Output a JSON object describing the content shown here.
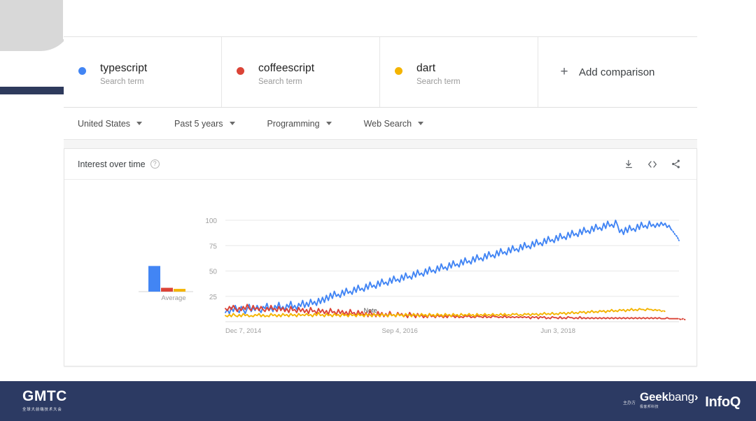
{
  "terms": [
    {
      "name": "typescript",
      "subtitle": "Search term",
      "color": "#4285F4",
      "dot_name": "legend-dot-typescript"
    },
    {
      "name": "coffeescript",
      "subtitle": "Search term",
      "color": "#DB4437",
      "dot_name": "legend-dot-coffeescript"
    },
    {
      "name": "dart",
      "subtitle": "Search term",
      "color": "#F4B400",
      "dot_name": "legend-dot-dart"
    }
  ],
  "add_comparison": {
    "plus": "+",
    "label": "Add comparison"
  },
  "filters": [
    {
      "label": "United States"
    },
    {
      "label": "Past 5 years"
    },
    {
      "label": "Programming"
    },
    {
      "label": "Web Search"
    }
  ],
  "card": {
    "title": "Interest over time",
    "help": "?",
    "actions": [
      {
        "name": "download-icon"
      },
      {
        "name": "embed-code-icon"
      },
      {
        "name": "share-icon"
      }
    ]
  },
  "banner": {
    "gmtc_main": "GMTC",
    "gmtc_sub": "全球大前端技术大会",
    "sponsor_label": "主办方",
    "geekbang_geek": "Geek",
    "geekbang_bang": "bang",
    "geekbang_arrow": "›",
    "geekbang_sub": "极客邦科技",
    "infoq": "InfoQ"
  },
  "chart_data": {
    "type": "line",
    "title": "Interest over time",
    "xlabel": "",
    "ylabel": "",
    "ylim": [
      0,
      100
    ],
    "yticks": [
      25,
      50,
      75,
      100
    ],
    "ytick_labels": [
      "25",
      "50",
      "75",
      "100"
    ],
    "xtick_labels": [
      "Dec 7, 2014",
      "Sep 4, 2016",
      "Jun 3, 2018"
    ],
    "xtick_positions": [
      0.0,
      0.345,
      0.695
    ],
    "grid": true,
    "legend": "top",
    "annotation": "Note",
    "annotation_pos": [
      0.305,
      0.09
    ],
    "partial_data_dotted_tail": true,
    "series": [
      {
        "name": "typescript",
        "color": "#4285F4",
        "average": 47,
        "values": [
          9,
          12,
          8,
          14,
          10,
          16,
          11,
          9,
          15,
          12,
          8,
          13,
          17,
          10,
          14,
          11,
          16,
          12,
          9,
          15,
          13,
          18,
          11,
          14,
          10,
          16,
          13,
          19,
          12,
          15,
          11,
          17,
          14,
          20,
          13,
          16,
          12,
          18,
          15,
          21,
          14,
          19,
          15,
          22,
          17,
          20,
          16,
          23,
          18,
          24,
          19,
          26,
          21,
          28,
          23,
          30,
          25,
          27,
          24,
          31,
          26,
          33,
          28,
          30,
          27,
          34,
          29,
          36,
          31,
          33,
          30,
          37,
          32,
          39,
          34,
          36,
          33,
          40,
          35,
          42,
          37,
          39,
          36,
          43,
          38,
          45,
          40,
          42,
          39,
          46,
          41,
          48,
          43,
          45,
          42,
          49,
          44,
          51,
          46,
          48,
          45,
          52,
          47,
          54,
          49,
          51,
          48,
          55,
          50,
          57,
          52,
          54,
          51,
          58,
          53,
          60,
          55,
          57,
          54,
          61,
          56,
          63,
          58,
          60,
          57,
          64,
          59,
          66,
          61,
          63,
          60,
          67,
          62,
          69,
          64,
          66,
          63,
          70,
          65,
          72,
          67,
          69,
          66,
          73,
          68,
          75,
          70,
          72,
          69,
          76,
          71,
          78,
          73,
          75,
          72,
          79,
          74,
          81,
          76,
          78,
          75,
          82,
          77,
          84,
          79,
          81,
          78,
          85,
          80,
          87,
          82,
          84,
          81,
          88,
          83,
          90,
          85,
          87,
          84,
          91,
          86,
          93,
          88,
          90,
          87,
          94,
          89,
          96,
          91,
          93,
          90,
          97,
          92,
          99,
          94,
          96,
          93,
          100,
          95,
          88,
          91,
          86,
          93,
          88,
          95,
          90,
          92,
          89,
          96,
          91,
          98,
          93,
          95,
          92,
          99,
          94,
          96,
          93,
          97,
          94,
          98,
          95,
          97,
          93,
          95,
          91,
          89,
          86,
          84,
          80
        ]
      },
      {
        "name": "coffeescript",
        "color": "#DB4437",
        "average": 7,
        "values": [
          13,
          11,
          15,
          12,
          16,
          13,
          10,
          14,
          11,
          15,
          12,
          17,
          13,
          11,
          16,
          12,
          14,
          11,
          15,
          12,
          10,
          14,
          11,
          16,
          12,
          13,
          10,
          15,
          11,
          14,
          10,
          13,
          9,
          15,
          11,
          12,
          9,
          14,
          10,
          13,
          9,
          12,
          8,
          14,
          10,
          11,
          8,
          13,
          9,
          12,
          8,
          11,
          7,
          13,
          9,
          10,
          7,
          12,
          8,
          11,
          7,
          10,
          6,
          12,
          8,
          9,
          6,
          11,
          7,
          10,
          6,
          9,
          5,
          11,
          7,
          8,
          5,
          10,
          6,
          9,
          5,
          8,
          5,
          10,
          6,
          7,
          5,
          9,
          6,
          8,
          5,
          7,
          4,
          9,
          6,
          7,
          4,
          8,
          5,
          7,
          4,
          6,
          4,
          8,
          5,
          6,
          4,
          7,
          5,
          6,
          4,
          6,
          4,
          7,
          5,
          6,
          4,
          6,
          4,
          5,
          4,
          6,
          5,
          6,
          4,
          5,
          4,
          6,
          5,
          5,
          4,
          6,
          4,
          5,
          4,
          6,
          5,
          5,
          4,
          5,
          4,
          6,
          4,
          5,
          4,
          5,
          4,
          5,
          4,
          5,
          4,
          5,
          4,
          5,
          3,
          5,
          4,
          5,
          3,
          5,
          4,
          5,
          3,
          4,
          3,
          5,
          4,
          4,
          3,
          5,
          3,
          4,
          3,
          5,
          4,
          4,
          3,
          4,
          3,
          5,
          3,
          4,
          3,
          4,
          3,
          4,
          3,
          4,
          3,
          4,
          3,
          4,
          3,
          4,
          3,
          4,
          3,
          4,
          3,
          4,
          3,
          4,
          3,
          4,
          3,
          4,
          3,
          4,
          3,
          4,
          3,
          4,
          3,
          4,
          3,
          4,
          3,
          4,
          3,
          4,
          3,
          3,
          3,
          4,
          3,
          3,
          3,
          3,
          3,
          3,
          2,
          3,
          2
        ]
      },
      {
        "name": "dart",
        "color": "#F4B400",
        "average": 5,
        "values": [
          6,
          5,
          7,
          5,
          8,
          6,
          5,
          7,
          5,
          8,
          6,
          7,
          5,
          6,
          5,
          7,
          6,
          8,
          5,
          7,
          5,
          6,
          5,
          8,
          6,
          7,
          5,
          7,
          5,
          8,
          6,
          7,
          5,
          8,
          6,
          7,
          5,
          8,
          6,
          7,
          6,
          8,
          6,
          7,
          5,
          8,
          6,
          9,
          6,
          7,
          5,
          8,
          6,
          7,
          5,
          8,
          6,
          7,
          5,
          8,
          6,
          7,
          5,
          8,
          6,
          7,
          5,
          8,
          6,
          7,
          5,
          8,
          6,
          7,
          5,
          8,
          6,
          7,
          5,
          8,
          6,
          7,
          5,
          8,
          6,
          7,
          5,
          8,
          6,
          7,
          5,
          8,
          6,
          7,
          5,
          8,
          6,
          7,
          5,
          8,
          6,
          7,
          5,
          8,
          6,
          7,
          5,
          8,
          6,
          7,
          5,
          8,
          6,
          7,
          5,
          8,
          6,
          7,
          5,
          8,
          6,
          7,
          6,
          8,
          6,
          7,
          5,
          8,
          6,
          7,
          6,
          8,
          6,
          7,
          6,
          8,
          6,
          7,
          6,
          8,
          6,
          8,
          6,
          7,
          6,
          8,
          7,
          8,
          6,
          7,
          6,
          8,
          7,
          8,
          6,
          8,
          7,
          8,
          6,
          8,
          7,
          9,
          7,
          8,
          7,
          9,
          7,
          8,
          7,
          9,
          8,
          9,
          7,
          9,
          8,
          10,
          8,
          9,
          8,
          10,
          9,
          10,
          8,
          10,
          9,
          11,
          9,
          10,
          9,
          11,
          10,
          11,
          9,
          11,
          10,
          12,
          10,
          11,
          10,
          12,
          11,
          12,
          10,
          12,
          11,
          13,
          11,
          12,
          11,
          13,
          12,
          12,
          11,
          13,
          12,
          12,
          11,
          12,
          11,
          12,
          10,
          11,
          10
        ]
      }
    ]
  }
}
